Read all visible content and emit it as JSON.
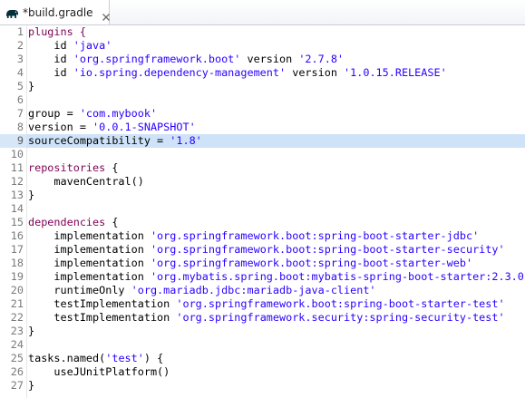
{
  "tab": {
    "title": "*build.gradle",
    "icon": "gradle-elephant-icon",
    "close_icon": "close-icon"
  },
  "editor": {
    "current_line": 9,
    "colors": {
      "keyword": "#7f0055",
      "string": "#2a00ff",
      "current_line_highlight": "#cfe3f8"
    },
    "lines": [
      {
        "n": "1",
        "tokens": [
          {
            "t": "plugins {",
            "k": "kw"
          }
        ]
      },
      {
        "n": "2",
        "tokens": [
          {
            "t": "    id ",
            "k": ""
          },
          {
            "t": "'java'",
            "k": "str"
          }
        ]
      },
      {
        "n": "3",
        "tokens": [
          {
            "t": "    id ",
            "k": ""
          },
          {
            "t": "'org.springframework.boot'",
            "k": "str"
          },
          {
            "t": " version ",
            "k": ""
          },
          {
            "t": "'2.7.8'",
            "k": "str"
          }
        ]
      },
      {
        "n": "4",
        "tokens": [
          {
            "t": "    id ",
            "k": ""
          },
          {
            "t": "'io.spring.dependency-management'",
            "k": "str"
          },
          {
            "t": " version ",
            "k": ""
          },
          {
            "t": "'1.0.15.RELEASE'",
            "k": "str"
          }
        ]
      },
      {
        "n": "5",
        "tokens": [
          {
            "t": "}",
            "k": ""
          }
        ]
      },
      {
        "n": "6",
        "tokens": []
      },
      {
        "n": "7",
        "tokens": [
          {
            "t": "group = ",
            "k": ""
          },
          {
            "t": "'com.mybook'",
            "k": "str"
          }
        ]
      },
      {
        "n": "8",
        "tokens": [
          {
            "t": "version = ",
            "k": ""
          },
          {
            "t": "'0.0.1-SNAPSHOT'",
            "k": "str"
          }
        ]
      },
      {
        "n": "9",
        "tokens": [
          {
            "t": "sourceCompatibility = ",
            "k": ""
          },
          {
            "t": "'1.8'",
            "k": "str"
          }
        ]
      },
      {
        "n": "10",
        "tokens": []
      },
      {
        "n": "11",
        "tokens": [
          {
            "t": "repositories",
            "k": "kw"
          },
          {
            "t": " {",
            "k": ""
          }
        ]
      },
      {
        "n": "12",
        "tokens": [
          {
            "t": "    mavenCentral()",
            "k": ""
          }
        ]
      },
      {
        "n": "13",
        "tokens": [
          {
            "t": "}",
            "k": ""
          }
        ]
      },
      {
        "n": "14",
        "tokens": []
      },
      {
        "n": "15",
        "tokens": [
          {
            "t": "dependencies",
            "k": "kw"
          },
          {
            "t": " {",
            "k": ""
          }
        ]
      },
      {
        "n": "16",
        "tokens": [
          {
            "t": "    implementation ",
            "k": ""
          },
          {
            "t": "'org.springframework.boot:spring-boot-starter-jdbc'",
            "k": "str"
          }
        ]
      },
      {
        "n": "17",
        "tokens": [
          {
            "t": "    implementation ",
            "k": ""
          },
          {
            "t": "'org.springframework.boot:spring-boot-starter-security'",
            "k": "str"
          }
        ]
      },
      {
        "n": "18",
        "tokens": [
          {
            "t": "    implementation ",
            "k": ""
          },
          {
            "t": "'org.springframework.boot:spring-boot-starter-web'",
            "k": "str"
          }
        ]
      },
      {
        "n": "19",
        "tokens": [
          {
            "t": "    implementation ",
            "k": ""
          },
          {
            "t": "'org.mybatis.spring.boot:mybatis-spring-boot-starter:2.3.0'",
            "k": "str"
          }
        ]
      },
      {
        "n": "20",
        "tokens": [
          {
            "t": "    runtimeOnly ",
            "k": ""
          },
          {
            "t": "'org.mariadb.jdbc:mariadb-java-client'",
            "k": "str"
          }
        ]
      },
      {
        "n": "21",
        "tokens": [
          {
            "t": "    testImplementation ",
            "k": ""
          },
          {
            "t": "'org.springframework.boot:spring-boot-starter-test'",
            "k": "str"
          }
        ]
      },
      {
        "n": "22",
        "tokens": [
          {
            "t": "    testImplementation ",
            "k": ""
          },
          {
            "t": "'org.springframework.security:spring-security-test'",
            "k": "str"
          }
        ]
      },
      {
        "n": "23",
        "tokens": [
          {
            "t": "}",
            "k": ""
          }
        ]
      },
      {
        "n": "24",
        "tokens": []
      },
      {
        "n": "25",
        "tokens": [
          {
            "t": "tasks.named(",
            "k": ""
          },
          {
            "t": "'test'",
            "k": "str"
          },
          {
            "t": ") {",
            "k": ""
          }
        ]
      },
      {
        "n": "26",
        "tokens": [
          {
            "t": "    useJUnitPlatform()",
            "k": ""
          }
        ]
      },
      {
        "n": "27",
        "tokens": [
          {
            "t": "}",
            "k": ""
          }
        ]
      }
    ]
  }
}
